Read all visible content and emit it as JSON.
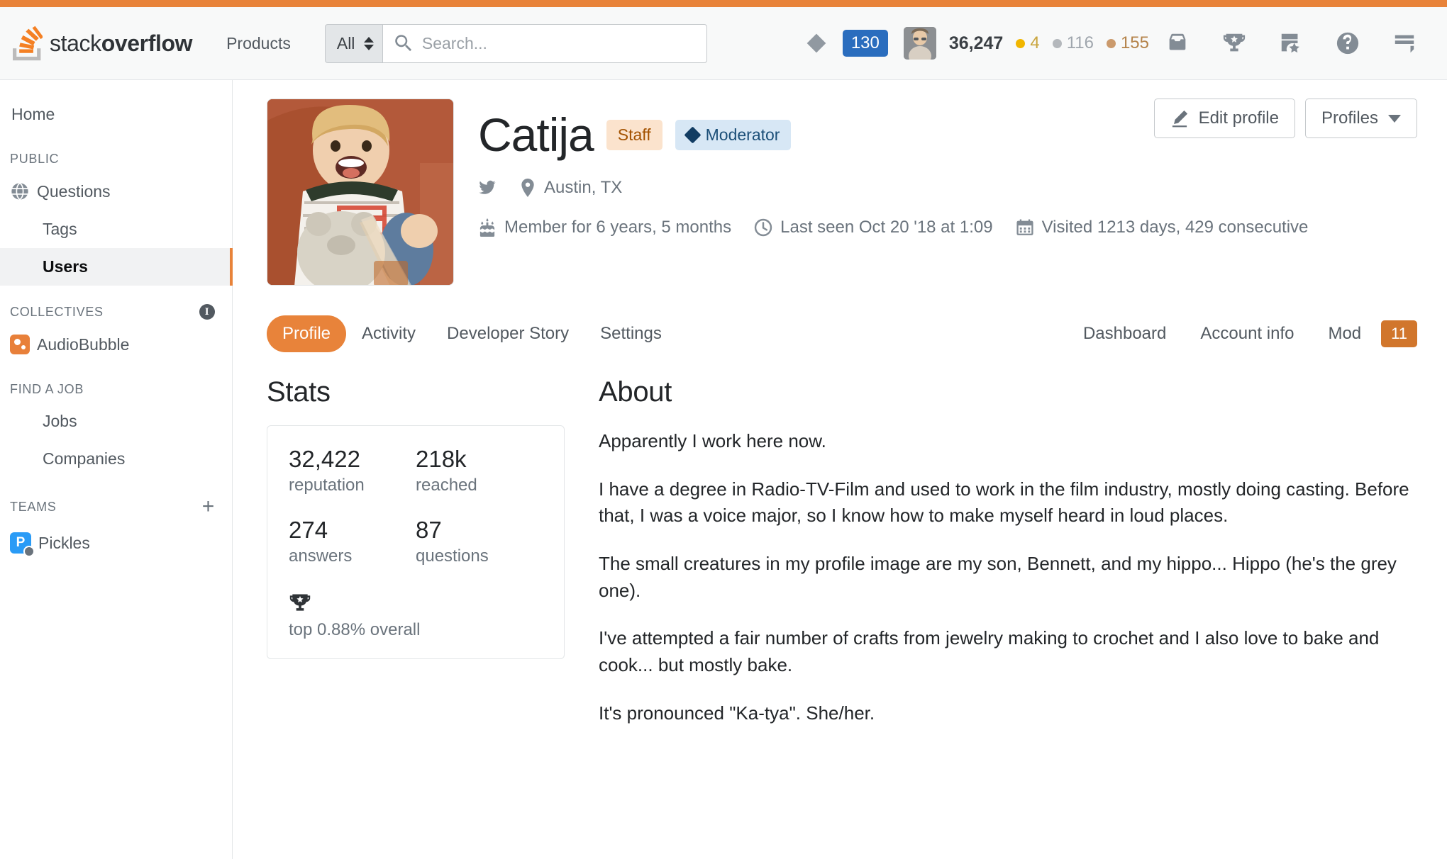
{
  "header": {
    "logo_text_thin": "stack",
    "logo_text_bold": "overflow",
    "products_label": "Products",
    "search": {
      "scope_value": "All",
      "placeholder": "Search..."
    },
    "reputation": "36,247",
    "blue_badge_count": "130",
    "badges": {
      "gold": "4",
      "silver": "116",
      "bronze": "155"
    },
    "icons": [
      "inbox-icon",
      "trophy-icon",
      "review-icon",
      "help-icon",
      "site-switcher-icon"
    ]
  },
  "sidebar": {
    "home_label": "Home",
    "public_heading": "PUBLIC",
    "public_items": [
      {
        "label": "Questions",
        "icon": "globe-icon",
        "active": false
      },
      {
        "label": "Tags",
        "icon": "",
        "active": false
      },
      {
        "label": "Users",
        "icon": "",
        "active": true
      }
    ],
    "collectives_heading": "COLLECTIVES",
    "collectives_items": [
      {
        "label": "AudioBubble",
        "icon": "audiobubble-icon"
      }
    ],
    "jobs_heading": "FIND A JOB",
    "jobs_items": [
      {
        "label": "Jobs"
      },
      {
        "label": "Companies"
      }
    ],
    "teams_heading": "TEAMS",
    "teams_add_label": "+",
    "teams_items": [
      {
        "label": "Pickles",
        "initial": "P"
      }
    ]
  },
  "profile": {
    "name": "Catija",
    "tag_staff": "Staff",
    "tag_moderator": "Moderator",
    "location": "Austin, TX",
    "member_for": "Member for 6 years, 5 months",
    "last_seen": "Last seen Oct 20 '18 at 1:09",
    "visited": "Visited 1213 days, 429 consecutive",
    "edit_profile_label": "Edit profile",
    "profiles_label": "Profiles"
  },
  "tabs": {
    "left": [
      {
        "label": "Profile",
        "active": true
      },
      {
        "label": "Activity",
        "active": false
      },
      {
        "label": "Developer Story",
        "active": false
      },
      {
        "label": "Settings",
        "active": false
      }
    ],
    "right": [
      {
        "label": "Dashboard"
      },
      {
        "label": "Account info"
      },
      {
        "label": "Mod"
      }
    ],
    "mod_count": "11"
  },
  "stats": {
    "title": "Stats",
    "items": [
      {
        "value": "32,422",
        "label": "reputation"
      },
      {
        "value": "218k",
        "label": "reached"
      },
      {
        "value": "274",
        "label": "answers"
      },
      {
        "value": "87",
        "label": "questions"
      }
    ],
    "footer_label": "top 0.88% overall"
  },
  "about": {
    "title": "About",
    "paragraphs": [
      "Apparently I work here now.",
      "I have a degree in Radio-TV-Film and used to work in the film industry, mostly doing casting. Before that, I was a voice major, so I know how to make myself heard in loud places.",
      "The small creatures in my profile image are my son, Bennett, and my hippo... Hippo (he's the grey one).",
      "I've attempted a fair number of crafts from jewelry making to crochet and I also love to bake and cook... but mostly bake.",
      "It's pronounced \"Ka-tya\". She/her."
    ]
  },
  "colors": {
    "accent_orange": "#e8833a",
    "badge_blue": "#2a6dbe",
    "mod_badge": "#d1762c",
    "staff_bg": "#fbe3cd",
    "mod_tag_bg": "#d7e7f5"
  }
}
